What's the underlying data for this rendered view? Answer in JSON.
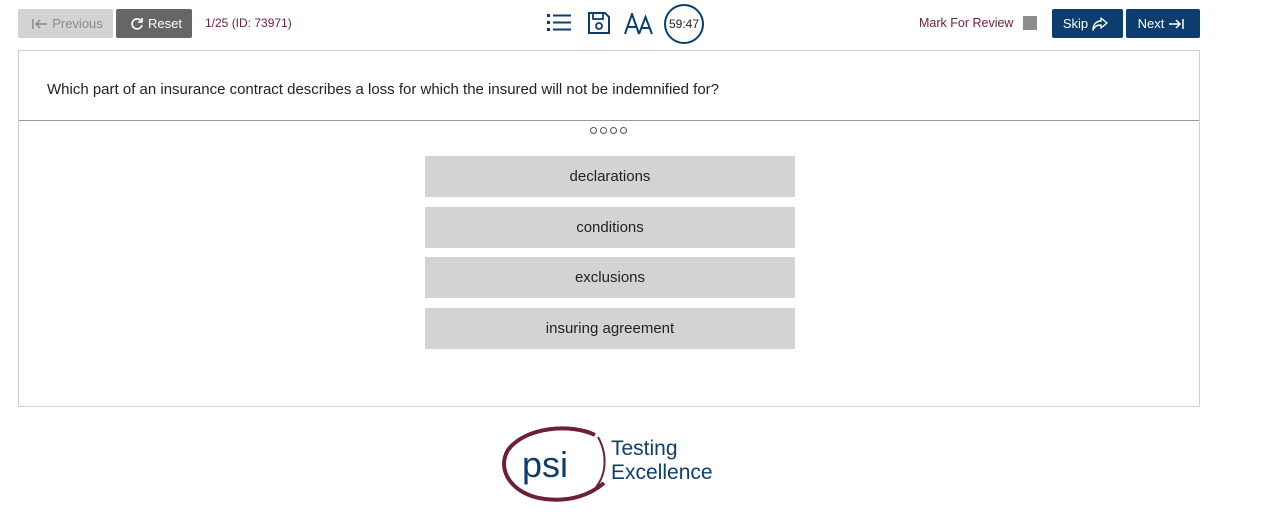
{
  "toolbar": {
    "previous_label": "Previous",
    "reset_label": "Reset",
    "question_info": "1/25 (ID: 73971)",
    "timer": "59:47",
    "mark_label": "Mark For Review",
    "skip_label": "Skip",
    "next_label": "Next",
    "icons": [
      "list-icon",
      "save-icon",
      "font-size-icon",
      "timer-icon"
    ]
  },
  "question": {
    "text": "Which part of an insurance contract describes a loss for which the insured will not be indemnified for?",
    "options": [
      "declarations",
      "conditions",
      "exclusions",
      "insuring agreement"
    ]
  },
  "logo": {
    "brand": "psi",
    "tagline_line1": "Testing",
    "tagline_line2": "Excellence"
  },
  "colors": {
    "accent": "#0c3d6e",
    "maroon": "#6d1f3a",
    "option_bg": "#d3d3d3"
  }
}
